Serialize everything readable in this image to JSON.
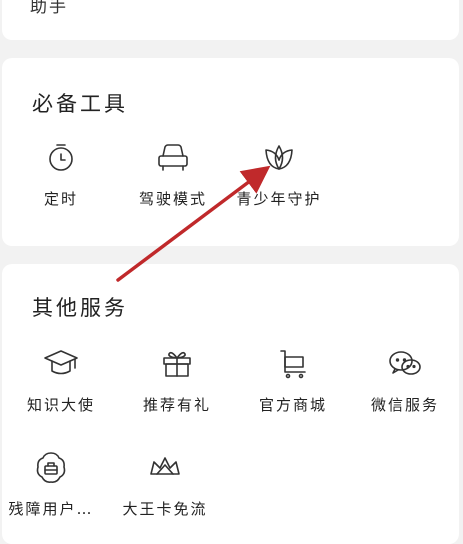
{
  "top_card": {
    "partial_text": "助手"
  },
  "tools": {
    "title": "必备工具",
    "items": [
      {
        "label": "定时",
        "icon": "timer-icon"
      },
      {
        "label": "驾驶模式",
        "icon": "car-icon"
      },
      {
        "label": "青少年守护",
        "icon": "leaf-icon"
      }
    ]
  },
  "other": {
    "title": "其他服务",
    "items": [
      {
        "label": "知识大使",
        "icon": "graduation-cap-icon"
      },
      {
        "label": "推荐有礼",
        "icon": "gift-icon"
      },
      {
        "label": "官方商城",
        "icon": "cart-icon"
      },
      {
        "label": "微信服务",
        "icon": "wechat-icon"
      },
      {
        "label": "残障用户…",
        "icon": "accessibility-icon"
      },
      {
        "label": "大王卡免流",
        "icon": "crown-card-icon"
      }
    ]
  },
  "annotation": {
    "arrow_color": "#c0292b",
    "target": "青少年守护"
  }
}
